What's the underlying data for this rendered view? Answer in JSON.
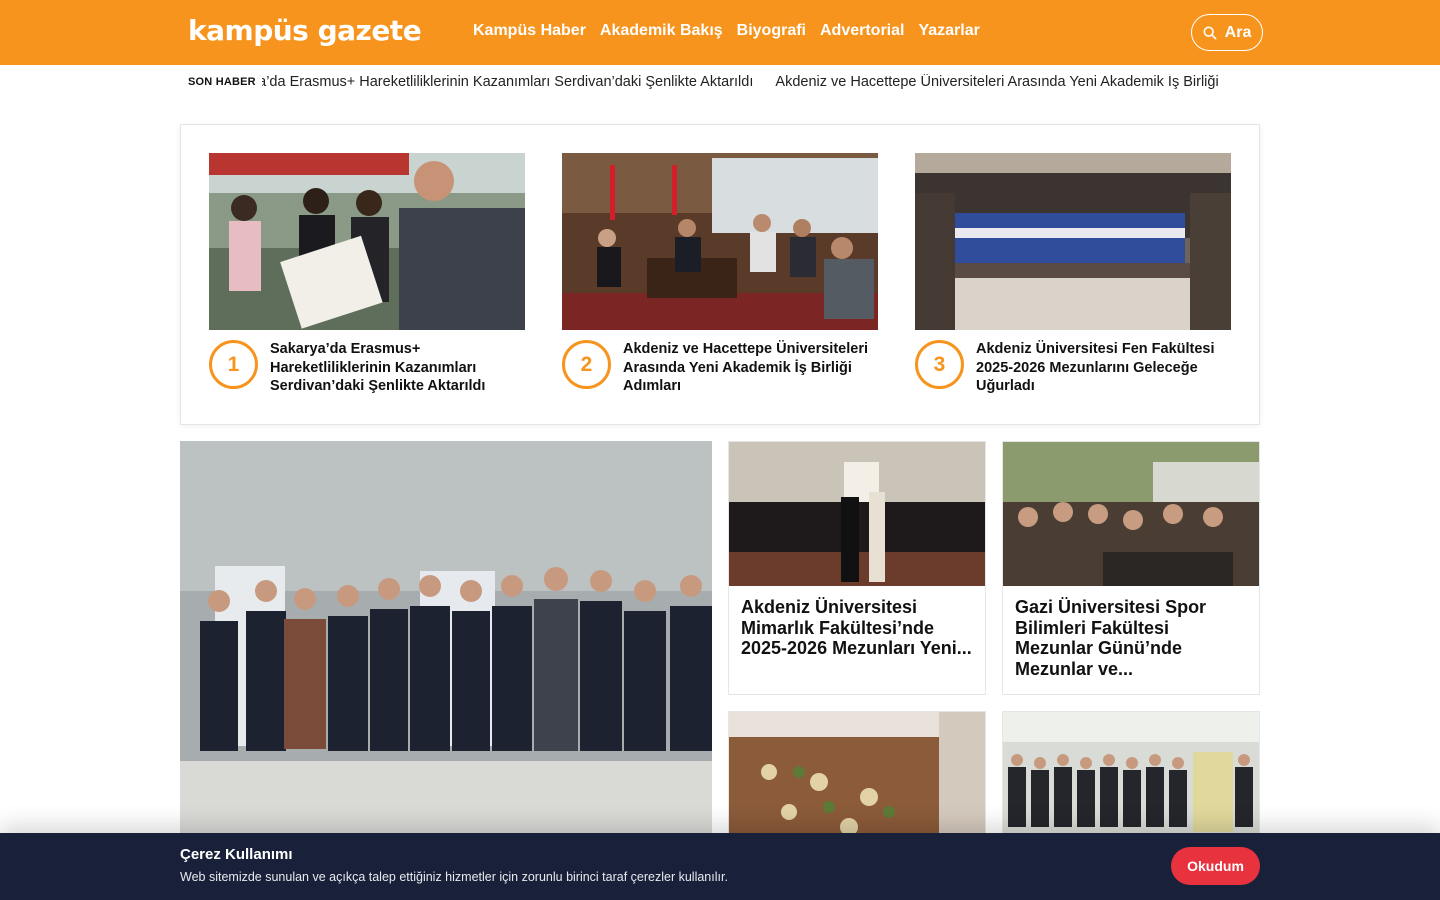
{
  "header": {
    "logo": "kampüs gazete",
    "nav": [
      "Kampüs Haber",
      "Akademik Bakış",
      "Biyografi",
      "Advertorial",
      "Yazarlar"
    ],
    "search_label": "Ara"
  },
  "ticker": {
    "label": "SON HABER",
    "items": [
      "Sakarya’da Erasmus+ Hareketliliklerinin Kazanımları Serdivan’daki Şenlikte Aktarıldı",
      "Akdeniz ve Hacettepe Üniversiteleri Arasında Yeni Akademik İş Birliği"
    ]
  },
  "top_stories": [
    {
      "number": "1",
      "title": "Sakarya’da Erasmus+ Hareketliliklerinin Kazanımları Serdivan’daki Şenlikte Aktarıldı"
    },
    {
      "number": "2",
      "title": "Akdeniz ve Hacettepe Üniversiteleri Arasında Yeni Akademik İş Birliği Adımları"
    },
    {
      "number": "3",
      "title": "Akdeniz Üniversitesi Fen Fakültesi 2025-2026 Mezunlarını Geleceğe Uğurladı"
    }
  ],
  "grid_cards": [
    {
      "title": "Akdeniz Üniversitesi Mimarlık Fakültesi’nde 2025-2026 Mezunları Yeni..."
    },
    {
      "title": "Gazi Üniversitesi Spor Bilimleri Fakültesi Mezunlar Günü’nde Mezunlar ve..."
    }
  ],
  "cookie": {
    "title": "Çerez Kullanımı",
    "text": "Web sitemizde sunulan ve açıkça talep ettiğiniz hizmetler için zorunlu birinci taraf çerezler kullanılır.",
    "button": "Okudum"
  },
  "colors": {
    "brand": "#f7941d",
    "cookie_bg": "#19213a",
    "cookie_button": "#e8323e"
  }
}
